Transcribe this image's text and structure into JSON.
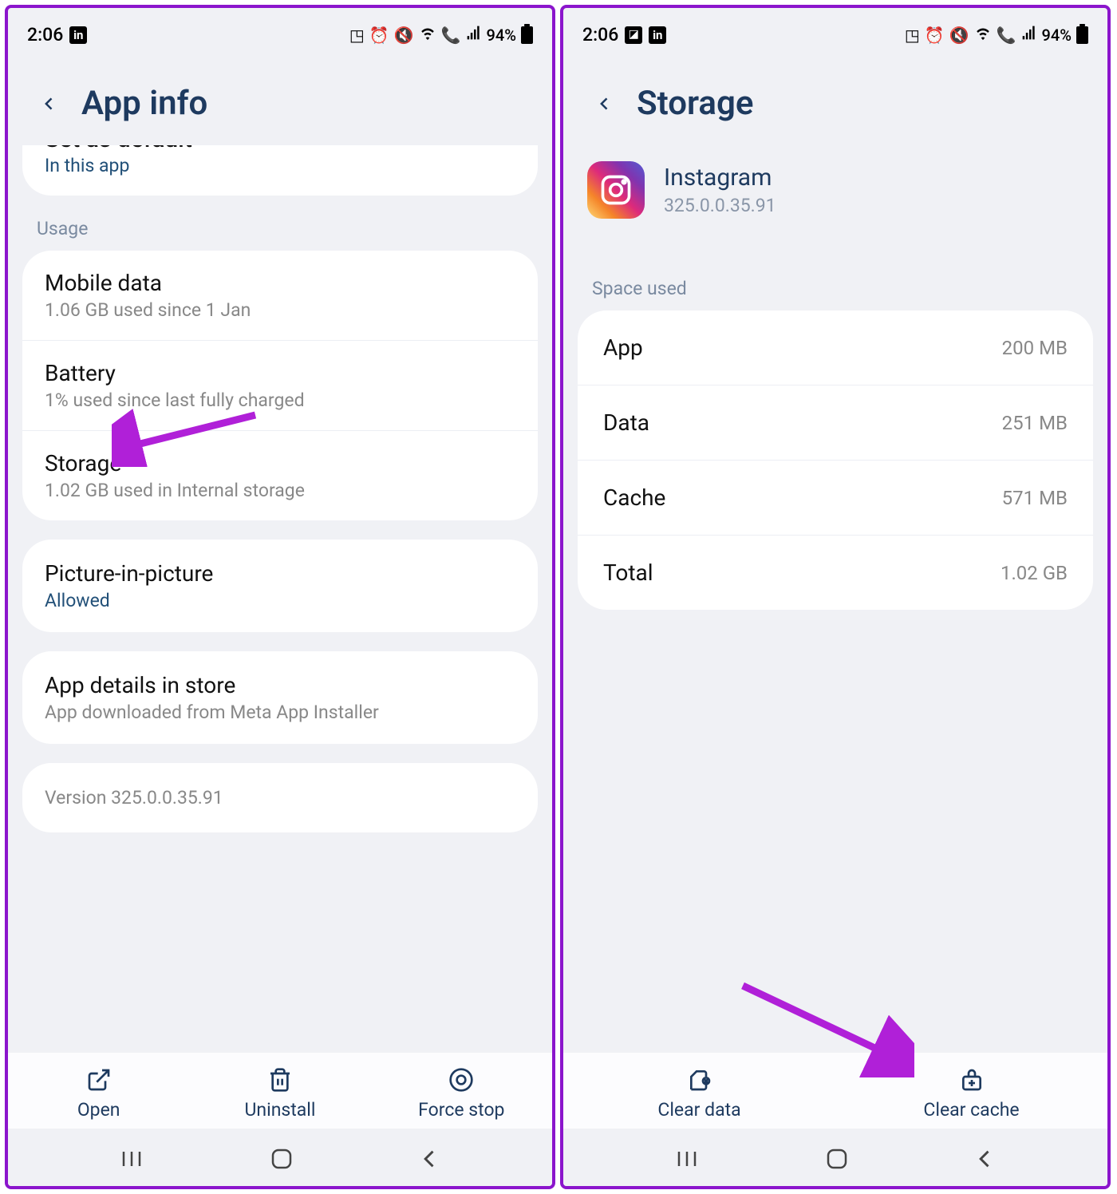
{
  "statusbar": {
    "time": "2:06",
    "battery_pct": "94%"
  },
  "left": {
    "title": "App info",
    "set_default": {
      "title": "Set as default",
      "sub": "In this app"
    },
    "usage_header": "Usage",
    "mobile_data": {
      "title": "Mobile data",
      "sub": "1.06 GB used since 1 Jan"
    },
    "battery": {
      "title": "Battery",
      "sub": "1% used since last fully charged"
    },
    "storage": {
      "title": "Storage",
      "sub": "1.02 GB used in Internal storage"
    },
    "pip": {
      "title": "Picture-in-picture",
      "sub": "Allowed"
    },
    "store": {
      "title": "App details in store",
      "sub": "App downloaded from Meta App Installer"
    },
    "version": "Version 325.0.0.35.91",
    "actions": {
      "open": "Open",
      "uninstall": "Uninstall",
      "force_stop": "Force stop"
    }
  },
  "right": {
    "title": "Storage",
    "app_name": "Instagram",
    "app_version": "325.0.0.35.91",
    "space_used_header": "Space used",
    "rows": {
      "app": {
        "label": "App",
        "value": "200 MB"
      },
      "data": {
        "label": "Data",
        "value": "251 MB"
      },
      "cache": {
        "label": "Cache",
        "value": "571 MB"
      },
      "total": {
        "label": "Total",
        "value": "1.02 GB"
      }
    },
    "actions": {
      "clear_data": "Clear data",
      "clear_cache": "Clear cache"
    }
  }
}
